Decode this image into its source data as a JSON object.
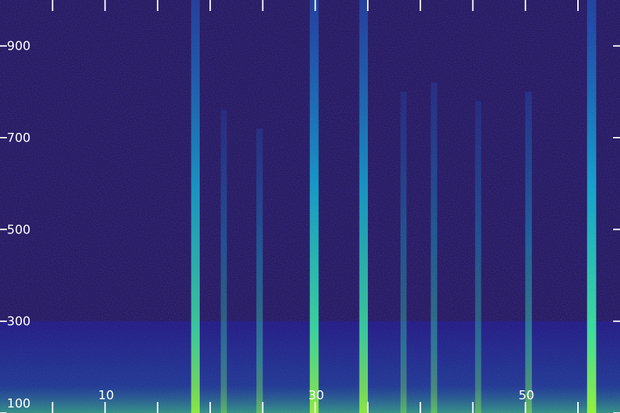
{
  "chart_data": {
    "type": "heatmap",
    "title": "",
    "xlabel": "",
    "ylabel": "",
    "xlim": [
      0,
      59
    ],
    "ylim": [
      100,
      1000
    ],
    "x_ticks": [
      {
        "value": 10,
        "label": "10"
      },
      {
        "value": 30,
        "label": "30"
      },
      {
        "value": 50,
        "label": "50"
      }
    ],
    "x_tick_marks": [
      5,
      10,
      15,
      20,
      25,
      30,
      35,
      40,
      45,
      50,
      55
    ],
    "y_ticks": [
      {
        "value": 100,
        "label": "100"
      },
      {
        "value": 300,
        "label": "300"
      },
      {
        "value": 500,
        "label": "500"
      },
      {
        "value": 700,
        "label": "700"
      },
      {
        "value": 900,
        "label": "900"
      }
    ],
    "colormap": [
      "#1a0033",
      "#1f1070",
      "#2020c0",
      "#1a70e8",
      "#10c8e8",
      "#40f0a0",
      "#a0ff30"
    ],
    "background_energy_cutoff": 300,
    "vertical_events": [
      {
        "x": 18.6,
        "intensity": 0.8,
        "top": 1000
      },
      {
        "x": 21.3,
        "intensity": 0.35,
        "top": 760
      },
      {
        "x": 24.7,
        "intensity": 0.4,
        "top": 720
      },
      {
        "x": 29.9,
        "intensity": 0.85,
        "top": 1000
      },
      {
        "x": 34.6,
        "intensity": 0.8,
        "top": 1000
      },
      {
        "x": 38.4,
        "intensity": 0.35,
        "top": 800
      },
      {
        "x": 41.3,
        "intensity": 0.4,
        "top": 820
      },
      {
        "x": 45.5,
        "intensity": 0.35,
        "top": 780
      },
      {
        "x": 50.3,
        "intensity": 0.45,
        "top": 800
      },
      {
        "x": 56.3,
        "intensity": 0.9,
        "top": 1000
      }
    ],
    "grid": false,
    "legend": "none"
  }
}
